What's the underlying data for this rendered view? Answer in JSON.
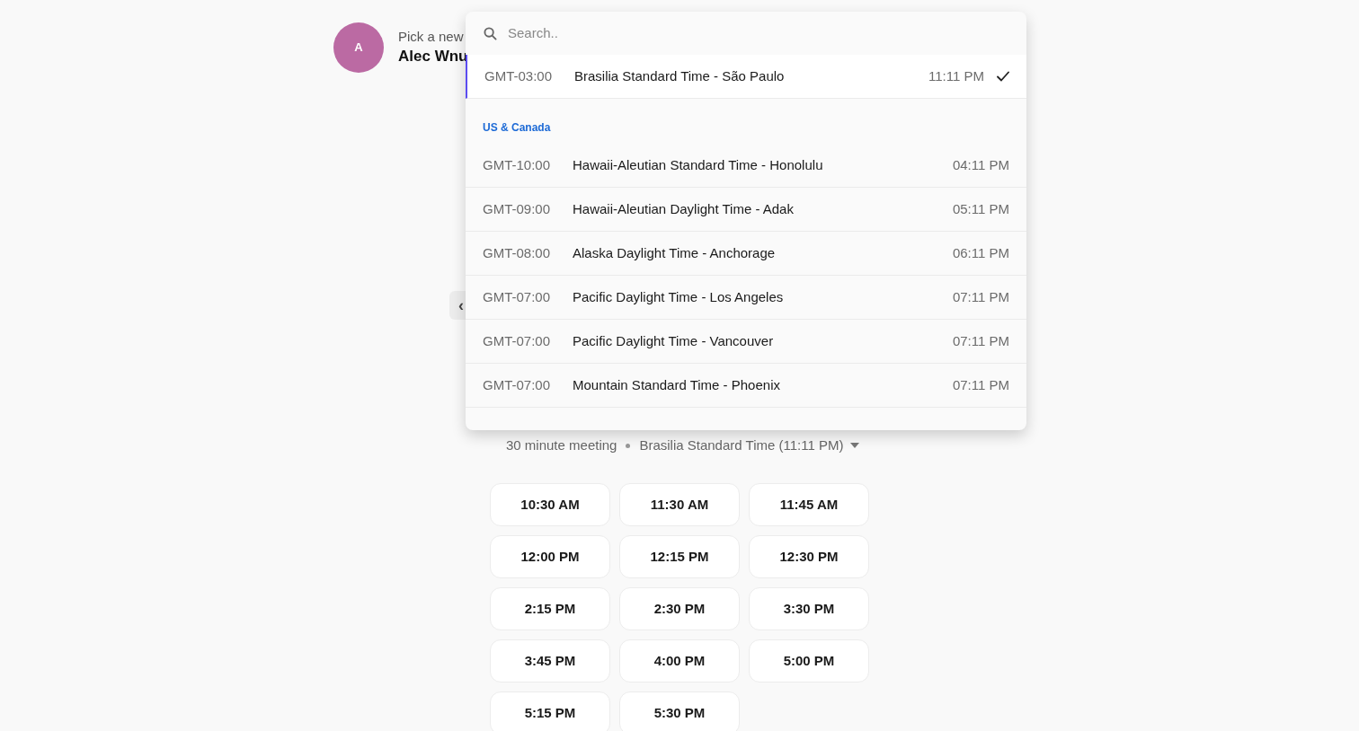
{
  "host": {
    "avatar_initial": "A",
    "prompt": "Pick a new",
    "name": "Alec Wnu"
  },
  "back_button": {
    "label": "‹"
  },
  "timezone_picker": {
    "search": {
      "placeholder": "Search.."
    },
    "current": {
      "offset": "GMT-03:00",
      "name": "Brasilia Standard Time - São Paulo",
      "time": "11:11 PM",
      "selected": true
    },
    "groups": [
      {
        "heading": "US & Canada",
        "items": [
          {
            "offset": "GMT-10:00",
            "name": "Hawaii-Aleutian Standard Time - Honolulu",
            "time": "04:11 PM",
            "selected": false
          },
          {
            "offset": "GMT-09:00",
            "name": "Hawaii-Aleutian Daylight Time - Adak",
            "time": "05:11 PM",
            "selected": false
          },
          {
            "offset": "GMT-08:00",
            "name": "Alaska Daylight Time - Anchorage",
            "time": "06:11 PM",
            "selected": false
          },
          {
            "offset": "GMT-07:00",
            "name": "Pacific Daylight Time - Los Angeles",
            "time": "07:11 PM",
            "selected": false
          },
          {
            "offset": "GMT-07:00",
            "name": "Pacific Daylight Time - Vancouver",
            "time": "07:11 PM",
            "selected": false
          },
          {
            "offset": "GMT-07:00",
            "name": "Mountain Standard Time - Phoenix",
            "time": "07:11 PM",
            "selected": false
          }
        ]
      }
    ]
  },
  "meeting": {
    "duration": "30 minute meeting",
    "timezone": "Brasilia Standard Time (11:11 PM)"
  },
  "slots": [
    "10:30 AM",
    "11:30 AM",
    "11:45 AM",
    "12:00 PM",
    "12:15 PM",
    "12:30 PM",
    "2:15 PM",
    "2:30 PM",
    "3:30 PM",
    "3:45 PM",
    "4:00 PM",
    "5:00 PM",
    "5:15 PM",
    "5:30 PM"
  ]
}
